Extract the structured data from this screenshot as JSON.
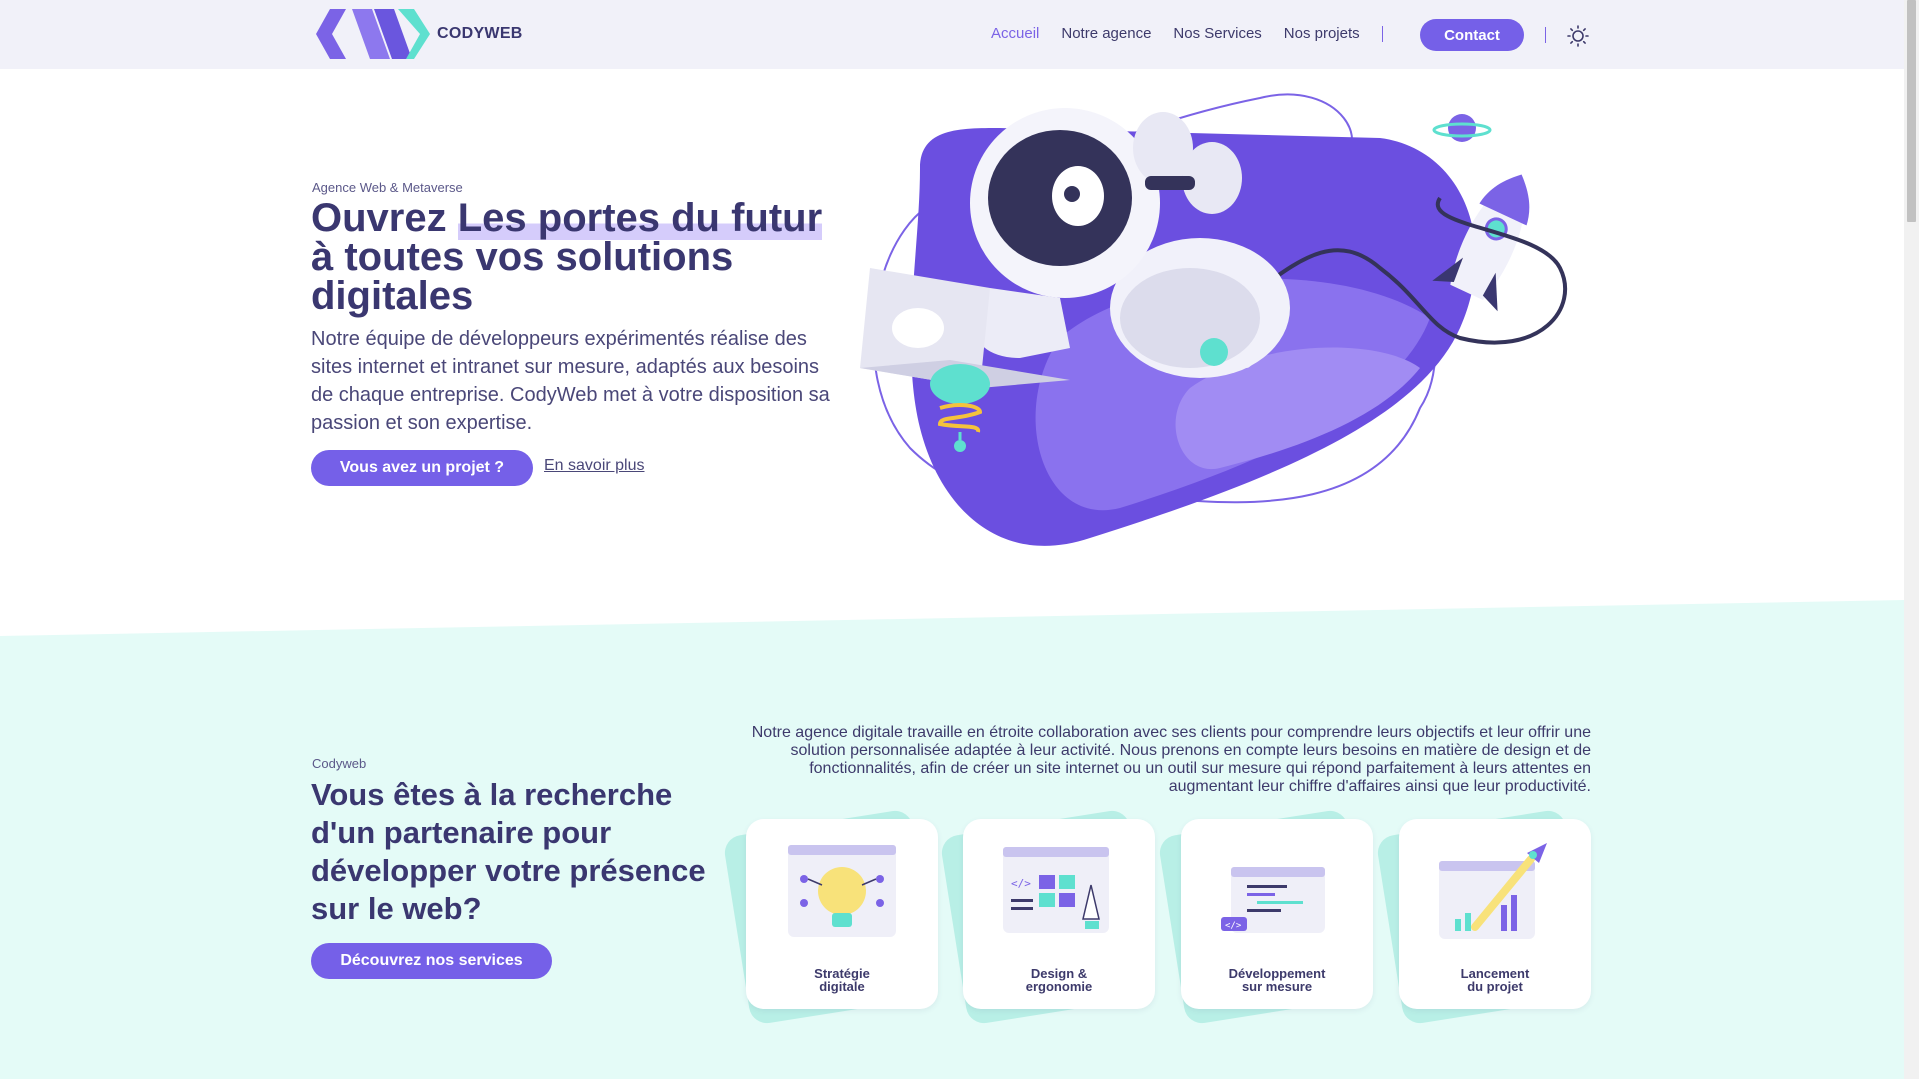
{
  "brand": {
    "name": "CODYWEB"
  },
  "nav": {
    "items": [
      {
        "label": "Accueil",
        "active": true
      },
      {
        "label": "Notre agence",
        "active": false
      },
      {
        "label": "Nos Services",
        "active": false
      },
      {
        "label": "Nos projets",
        "active": false
      }
    ],
    "contact_label": "Contact",
    "theme_toggle_icon": "sun-icon"
  },
  "hero": {
    "eyebrow": "Agence Web & Metaverse",
    "title_start": "Ouvrez ",
    "title_highlight": "Les portes du futur",
    "title_end": " à toutes vos solutions digitales",
    "description": "Notre équipe de développeurs expérimentés réalise des sites internet et intranet sur mesure, adaptés aux besoins de chaque entreprise. CodyWeb met à votre disposition sa passion et son expertise.",
    "cta_label": "Vous avez un projet ?",
    "link_label": "En savoir plus"
  },
  "services": {
    "eyebrow": "Codyweb",
    "title": "Vous êtes à la recherche d'un partenaire pour développer votre présence sur le web?",
    "cta_label": "Découvrez nos services",
    "description": "Notre agence digitale travaille en étroite collaboration avec ses clients pour comprendre leurs objectifs et leur offrir une solution personnalisée adaptée à leur activité. Nous prenons en compte leurs besoins en matière de design et de fonctionnalités, afin de créer un site internet ou un outil sur mesure qui répond parfaitement à leurs attentes en augmentant leur chiffre d'affaires ainsi que leur productivité.",
    "cards": [
      {
        "line1": "Stratégie",
        "line2": "digitale",
        "icon": "lightbulb-icon"
      },
      {
        "line1": "Design &",
        "line2": "ergonomie",
        "icon": "design-icon"
      },
      {
        "line1": "Développement",
        "line2": "sur mesure",
        "icon": "code-icon"
      },
      {
        "line1": "Lancement",
        "line2": "du projet",
        "icon": "rocket-chart-icon"
      }
    ]
  },
  "colors": {
    "accent": "#7560e8",
    "heading": "#3a3770",
    "mint": "#e4fbf7",
    "header_bg": "#f1f1f9"
  }
}
